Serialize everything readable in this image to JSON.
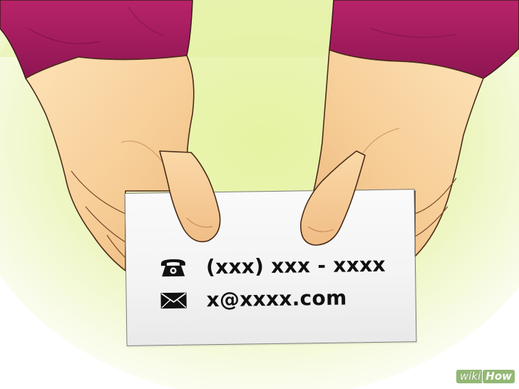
{
  "card": {
    "phone_text": "(xxx) xxx - xxxx",
    "email_text": "x@xxxx.com",
    "phone_icon": "phone-icon",
    "email_icon": "envelope-icon"
  },
  "watermark": {
    "wiki": "wiki",
    "how": "How"
  },
  "colors": {
    "background": "#e6f0a6",
    "sleeve": "#a2195e",
    "skin": "#f8d3a0",
    "card": "#f4f4f4",
    "text": "#111111",
    "logo": "#93b874"
  }
}
